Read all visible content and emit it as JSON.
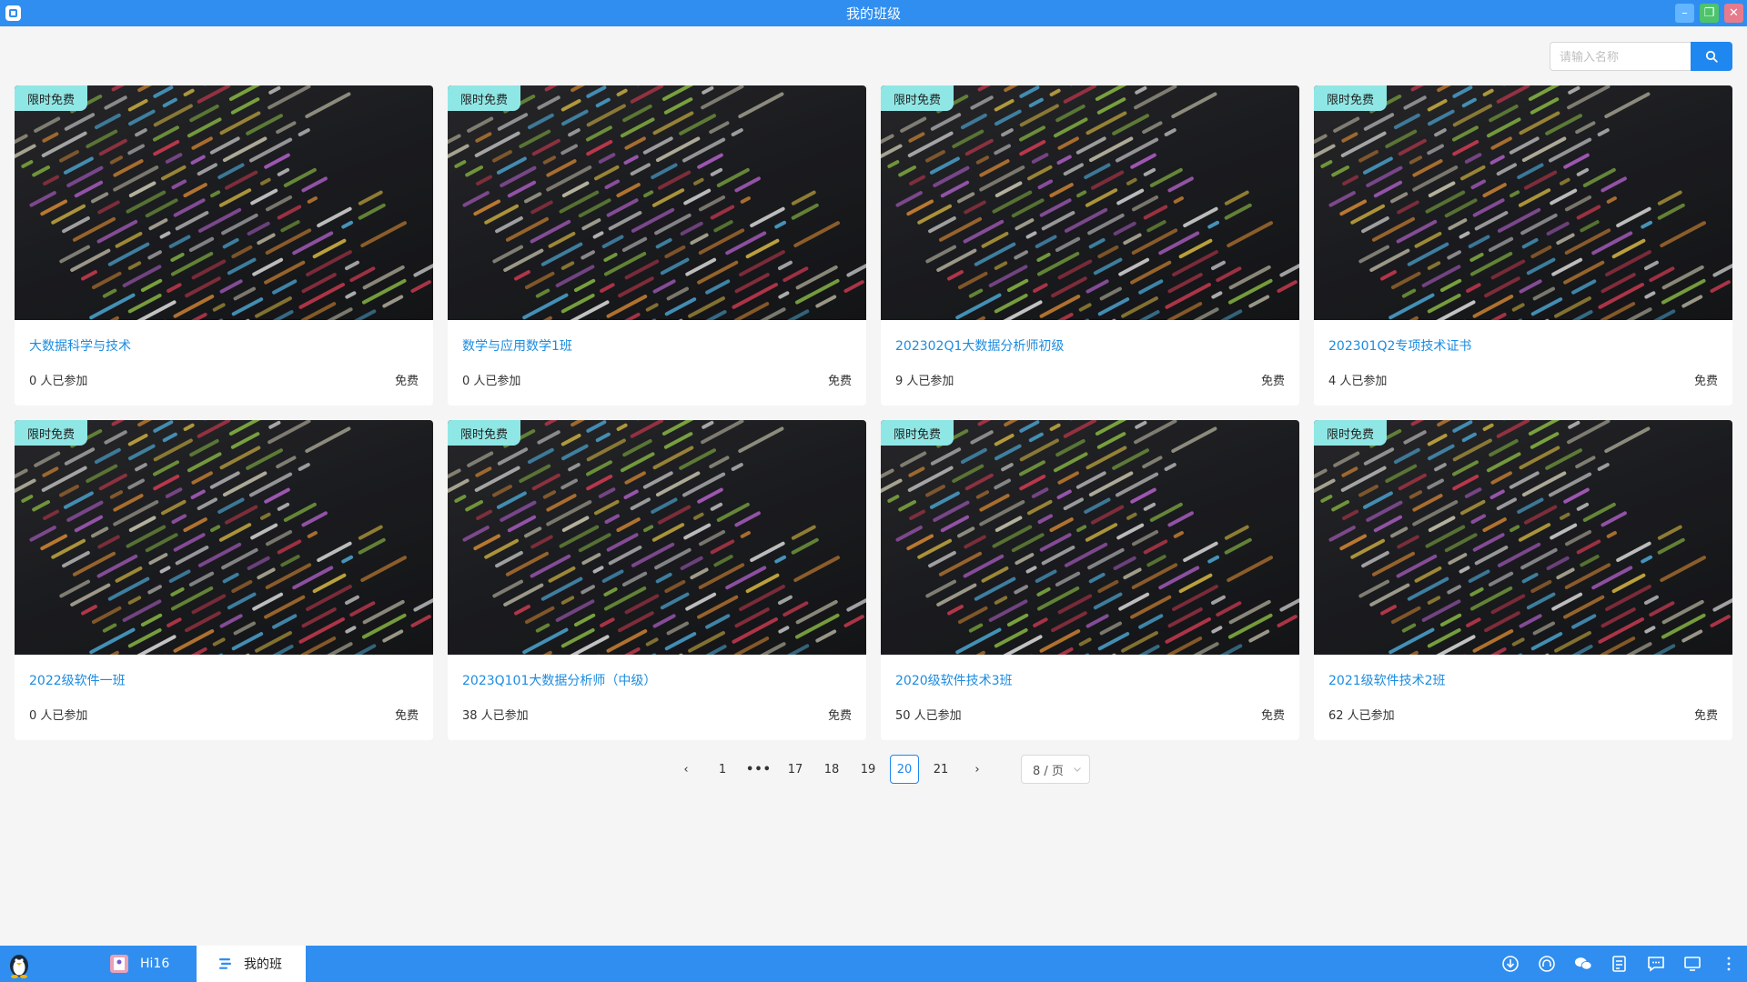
{
  "window": {
    "title": "我的班级",
    "controls": {
      "minimize": "–",
      "maximize": "❐",
      "close": "✕"
    }
  },
  "search": {
    "placeholder": "请输入名称",
    "value": ""
  },
  "cards": [
    {
      "badge": "限时免费",
      "title": "大数据科学与技术",
      "participants": "0 人已参加",
      "price": "免费"
    },
    {
      "badge": "限时免费",
      "title": "数学与应用数学1班",
      "participants": "0 人已参加",
      "price": "免费"
    },
    {
      "badge": "限时免费",
      "title": "202302Q1大数据分析师初级",
      "participants": "9 人已参加",
      "price": "免费"
    },
    {
      "badge": "限时免费",
      "title": "202301Q2专项技术证书",
      "participants": "4 人已参加",
      "price": "免费"
    },
    {
      "badge": "限时免费",
      "title": "2022级软件一班",
      "participants": "0 人已参加",
      "price": "免费"
    },
    {
      "badge": "限时免费",
      "title": "2023Q101大数据分析师（中级）",
      "participants": "38 人已参加",
      "price": "免费"
    },
    {
      "badge": "限时免费",
      "title": "2020级软件技术3班",
      "participants": "50 人已参加",
      "price": "免费"
    },
    {
      "badge": "限时免费",
      "title": "2021级软件技术2班",
      "participants": "62 人已参加",
      "price": "免费"
    }
  ],
  "pagination": {
    "prev": "‹",
    "next": "›",
    "pages": [
      "1",
      "•••",
      "17",
      "18",
      "19",
      "20",
      "21"
    ],
    "current": "20",
    "page_size": "8 / 页"
  },
  "taskbar": {
    "tabs": [
      {
        "label": "Hi16",
        "icon": "hi16-app-icon"
      },
      {
        "label": "我的班",
        "icon": "class-list-icon"
      }
    ],
    "tray_icons": [
      "download-icon",
      "headphones-icon",
      "wechat-icon",
      "notes-icon",
      "chat-icon",
      "monitor-icon",
      "more-icon"
    ]
  },
  "colors": {
    "accent": "#2f8ef0",
    "link": "#1d8ce0",
    "badge_bg": "#8fe7e5"
  }
}
